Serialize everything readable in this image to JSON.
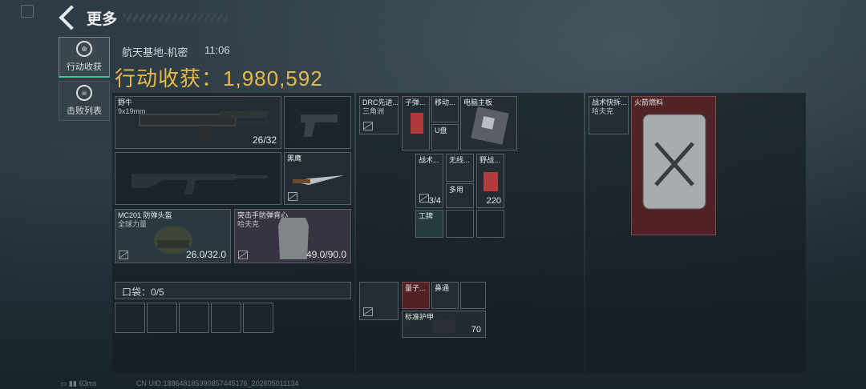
{
  "header": {
    "title": "更多"
  },
  "side": {
    "tab_loot": "行动收获",
    "tab_kills": "击败列表"
  },
  "info": {
    "location": "航天基地-机密",
    "time": "11:06",
    "total_label": "行动收获：",
    "total_value": "1,980,592"
  },
  "weapon1": {
    "name": "野牛",
    "ammo": "9x19mm",
    "count": "26/32"
  },
  "knife": {
    "name": "黑鹰"
  },
  "helmet": {
    "name": "MC201 防弹头盔",
    "sub": "全球力量",
    "dur": "26.0/32.0"
  },
  "armor": {
    "name": "突击手防弹背心",
    "sub": "哈夫克",
    "dur": "49.0/90.0"
  },
  "pocket": {
    "label": "口袋：",
    "count": "0/5"
  },
  "rig": {
    "item1": "DRC先进...",
    "item1_sub": "三角洲"
  },
  "mid": {
    "bullet": "子弹...",
    "move": "移动...",
    "usb": "U盘",
    "board": "电脑主板",
    "tactical": "战术...",
    "tact_count": "3/4",
    "wireless": "无线...",
    "multi": "多用",
    "field": "野战...",
    "field_val": "220",
    "tool": "工牌",
    "quantum": "量子...",
    "express": "鼻通",
    "armor_label": "标准护甲",
    "armor_val": "70"
  },
  "right": {
    "bag": "战术快拆...",
    "bag_sub": "哈夫克",
    "fuel": "火箭燃料"
  },
  "status": {
    "ping": "63ms",
    "uid": "CN UID:188648185390857445176_202605011134"
  },
  "colors": {
    "gold": "#e8b84a",
    "green": "#3cc88f",
    "red": "#7d2f32"
  }
}
